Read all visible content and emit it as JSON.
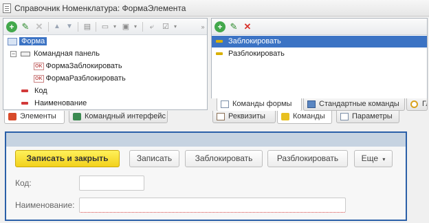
{
  "window": {
    "title": "Справочник Номенклатура: ФормаЭлемента"
  },
  "elements_tree": {
    "items": [
      {
        "label": "Форма",
        "selected": true
      },
      {
        "label": "Командная панель"
      },
      {
        "label": "ФормаЗаблокировать"
      },
      {
        "label": "ФормаРазблокировать"
      },
      {
        "label": "Код"
      },
      {
        "label": "Наименование"
      }
    ]
  },
  "commands_list": {
    "items": [
      {
        "label": "Заблокировать",
        "selected": true
      },
      {
        "label": "Разблокировать"
      }
    ]
  },
  "icons": {
    "ok_badge": "OK"
  },
  "left_tabs": [
    {
      "label": "Элементы",
      "active": true
    },
    {
      "label": "Командный интерфейс"
    }
  ],
  "right_subtabs": [
    {
      "label": "Команды формы",
      "active": true
    },
    {
      "label": "Стандартные команды"
    },
    {
      "label": "Гл"
    }
  ],
  "right_tabs": [
    {
      "label": "Реквизиты"
    },
    {
      "label": "Команды",
      "active": true
    },
    {
      "label": "Параметры"
    }
  ],
  "preview": {
    "buttons": {
      "save_close": "Записать и закрыть",
      "save": "Записать",
      "lock": "Заблокировать",
      "unlock": "Разблокировать",
      "more": "Еще"
    },
    "fields": {
      "code_label": "Код:",
      "code_value": "",
      "name_label": "Наименование:",
      "name_value": ""
    }
  },
  "colors": {
    "accent": "#3b73c4",
    "primary_button": "#f2d11c",
    "preview_border": "#2a5fa8"
  }
}
